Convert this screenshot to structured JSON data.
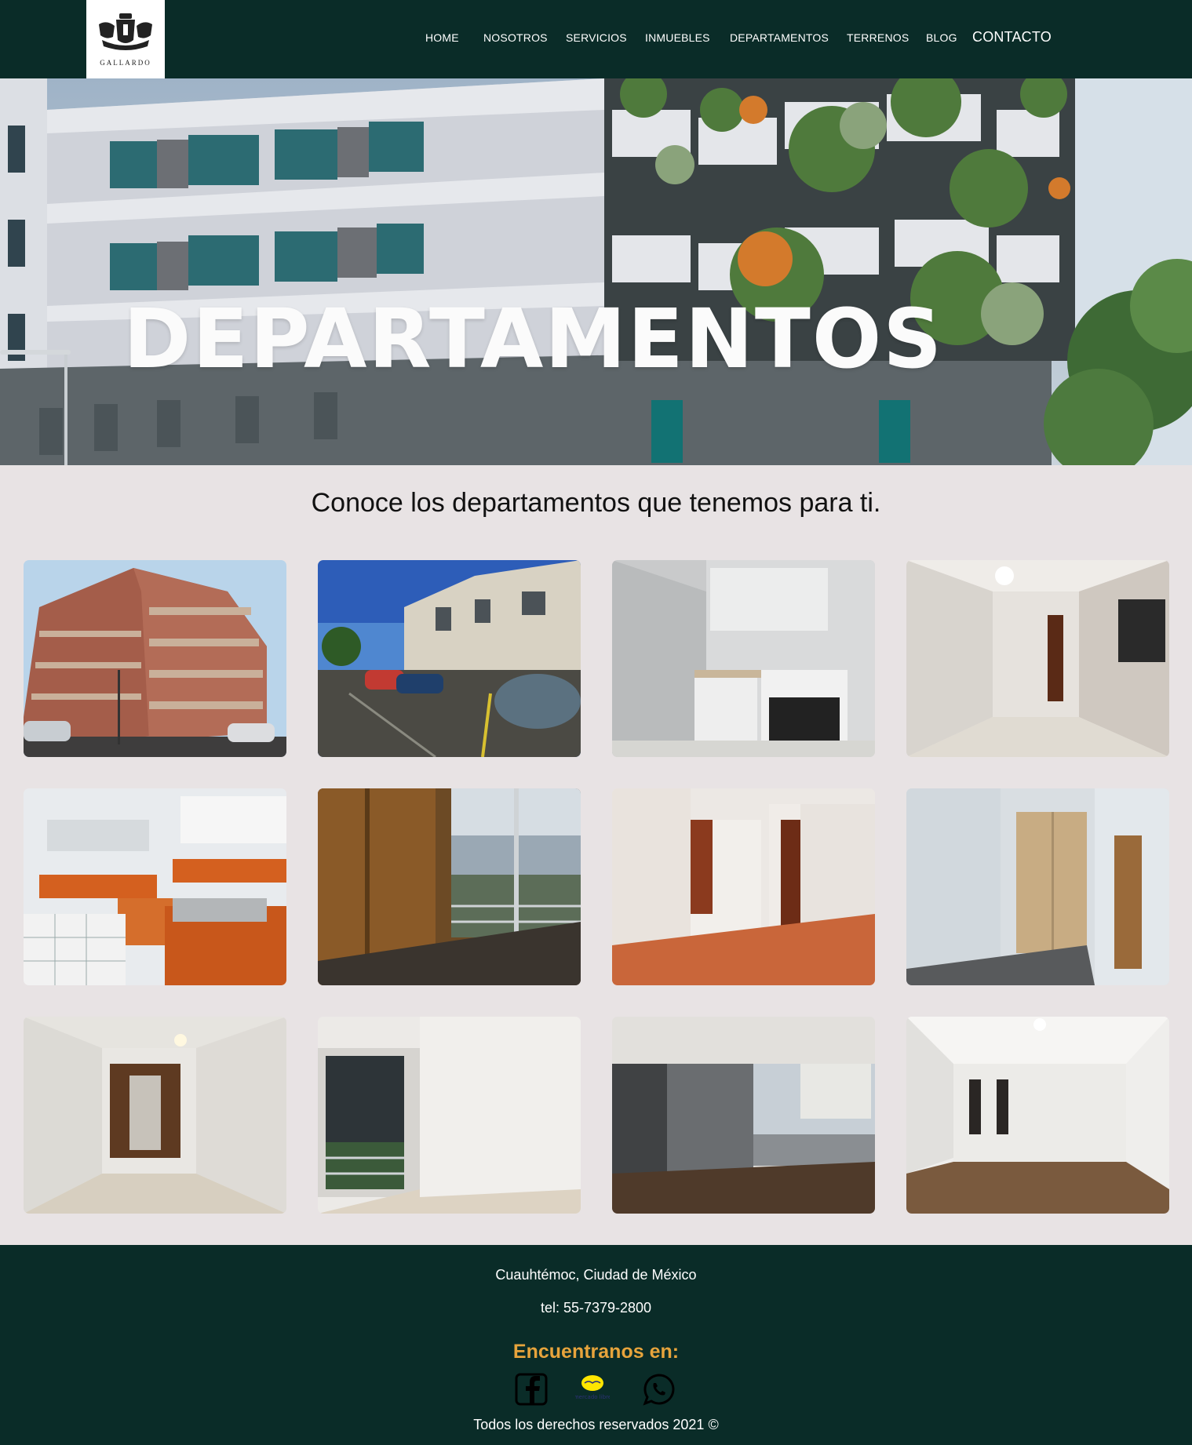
{
  "header": {
    "logo_text": "GALLARDO",
    "nav": [
      {
        "label": "HOME"
      },
      {
        "label": "NOSOTROS"
      },
      {
        "label": "SERVICIOS"
      },
      {
        "label": "INMUEBLES"
      },
      {
        "label": "DEPARTAMENTOS"
      },
      {
        "label": "TERRENOS"
      },
      {
        "label": "BLOG"
      },
      {
        "label": "CONTACTO"
      }
    ]
  },
  "hero": {
    "title": "DEPARTAMENTOS"
  },
  "intro": "Conoce los departamentos que tenemos para ti.",
  "gallery": [
    {
      "subject": "building-exterior"
    },
    {
      "subject": "parking-lot"
    },
    {
      "subject": "kitchen"
    },
    {
      "subject": "hallway"
    },
    {
      "subject": "kitchen-orange"
    },
    {
      "subject": "room-balcony"
    },
    {
      "subject": "living-room"
    },
    {
      "subject": "bedroom-closet"
    },
    {
      "subject": "bedroom-wardrobe"
    },
    {
      "subject": "room-glass-door"
    },
    {
      "subject": "living-room-window"
    },
    {
      "subject": "empty-room"
    }
  ],
  "footer": {
    "location": "Cuauhtémoc, Ciudad de México",
    "phone": "tel: 55-7379-2800",
    "find_us": "Encuentranos en:",
    "social_icons": [
      "facebook-icon",
      "mercado-libre-icon",
      "whatsapp-icon"
    ],
    "mercado_libre_text": "mercado libre",
    "copyright": "Todos los derechos reservados 2021 ©"
  },
  "colors": {
    "header_bg": "#0a2c28",
    "page_bg": "#e8e3e4",
    "accent": "#e7a43c"
  }
}
